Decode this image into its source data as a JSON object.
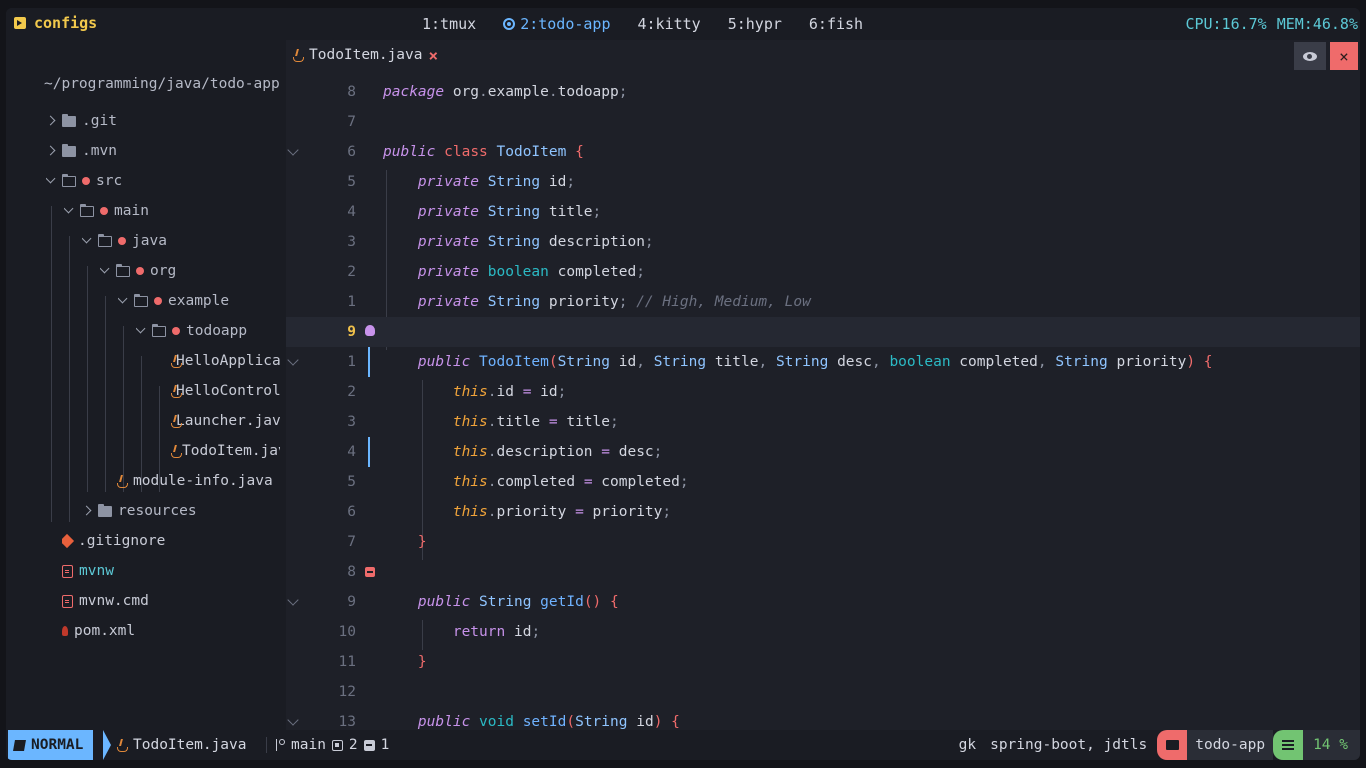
{
  "tmux": {
    "session": "configs",
    "windows": [
      {
        "label": "1:tmux",
        "active": false
      },
      {
        "label": "2:todo-app",
        "active": true
      },
      {
        "label": "4:kitty",
        "active": false
      },
      {
        "label": "5:hypr",
        "active": false
      },
      {
        "label": "6:fish",
        "active": false
      }
    ],
    "cpu": "CPU:16.7%",
    "mem": "MEM:46.8%"
  },
  "sidebar": {
    "root": "~/programming/java/todo-app",
    "items": [
      {
        "label": ".git"
      },
      {
        "label": ".mvn"
      },
      {
        "label": "src"
      },
      {
        "label": "main"
      },
      {
        "label": "java"
      },
      {
        "label": "org"
      },
      {
        "label": "example"
      },
      {
        "label": "todoapp"
      },
      {
        "label": "HelloApplication.java"
      },
      {
        "label": "HelloController.java"
      },
      {
        "label": "Launcher.java"
      },
      {
        "label": "TodoItem.java"
      },
      {
        "label": "module-info.java"
      },
      {
        "label": "resources"
      },
      {
        "label": ".gitignore"
      },
      {
        "label": "mvnw"
      },
      {
        "label": "mvnw.cmd"
      },
      {
        "label": "pom.xml"
      }
    ]
  },
  "editor": {
    "tab_name": "TodoItem.java",
    "tab_close": "×",
    "close_button": "×",
    "line_numbers": [
      "8",
      "7",
      "6",
      "5",
      "4",
      "3",
      "2",
      "1",
      "9",
      "1",
      "2",
      "3",
      "4",
      "5",
      "6",
      "7",
      "8",
      "9",
      "10",
      "11",
      "12",
      "13"
    ]
  },
  "statusline": {
    "mode": "NORMAL",
    "file": "TodoItem.java",
    "branch": "main",
    "diag_a": "2",
    "diag_b": "1",
    "gk": "gk",
    "lsp": "spring-boot, jdtls",
    "project": "todo-app",
    "percent": "14 %"
  },
  "colors": {
    "accent": "#6bb6ff",
    "error": "#ef6b6b",
    "session": "#f2c94c",
    "ok": "#72c472"
  }
}
